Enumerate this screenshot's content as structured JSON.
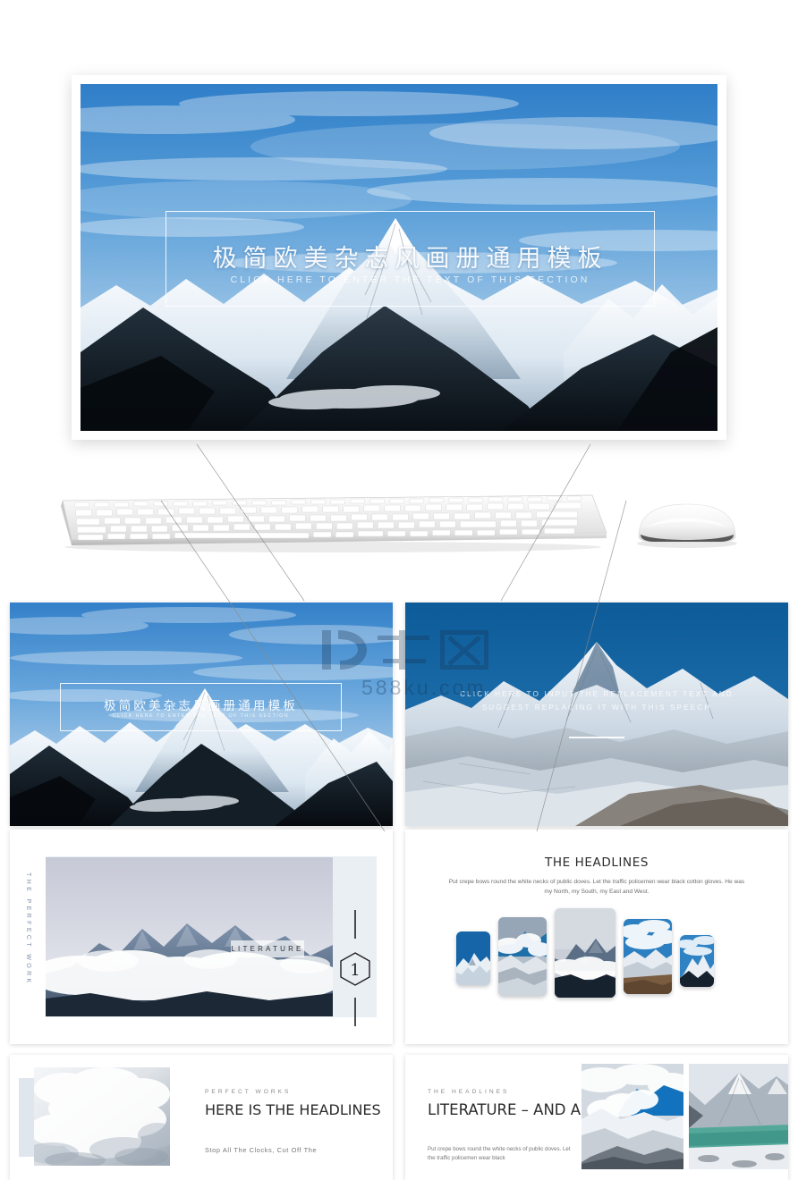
{
  "hero": {
    "title": "极简欧美杂志风画册通用模板",
    "subtitle": "CLICK HERE TO ENTER THE TEXT OF THIS SECTION"
  },
  "watermark": {
    "logo_text": "千库网",
    "domain": "588ku.com"
  },
  "devices": {
    "keyboard": "keyboard-mockup",
    "mouse": "mouse-mockup"
  },
  "slides": [
    {
      "id": "slide-cover",
      "name": "cover-slide",
      "title": "极简欧美杂志风画册通用模板",
      "subtitle": "CLICK HERE TO ENTER THE TEXT OF THIS SECTION"
    },
    {
      "id": "slide-intro",
      "name": "intro-slide",
      "body": "CLICK HERE TO INPUT THE REPLACEMENT TEXT AND SUGGEST REPLACING IT WITH THIS SPEECH"
    },
    {
      "id": "slide-section",
      "name": "section-divider-slide",
      "vertical_label": "THE PERFECT WORK",
      "badge": "LITERATURE",
      "number": "1"
    },
    {
      "id": "slide-gallery",
      "name": "gallery-slide",
      "title": "THE HEADLINES",
      "body": "Put crepe bows round the white necks of public doves. Let the traffic policemen wear black cotton gloves. He was my North, my South, my East and West."
    },
    {
      "id": "slide-feature",
      "name": "feature-slide",
      "kicker": "PERFECT WORKS",
      "headline": "HERE IS THE HEADLINES",
      "body": "Stop All The Clocks, Cut Off The"
    },
    {
      "id": "slide-literature",
      "name": "literature-slide",
      "kicker": "THE HEADLINES",
      "headline": "LITERATURE – AND ART",
      "body": "Put crepe bows round the white necks of public doves. Let the traffic policemen wear black"
    }
  ],
  "colors": {
    "sky_blue": "#4a90d9",
    "deep_blue": "#1b5c96",
    "panel_gray": "#eaeff4",
    "accent_block": "#dfe6ee",
    "text_dark": "#2b2b2b",
    "text_muted": "#777777",
    "page_bg": "#ffffff"
  }
}
